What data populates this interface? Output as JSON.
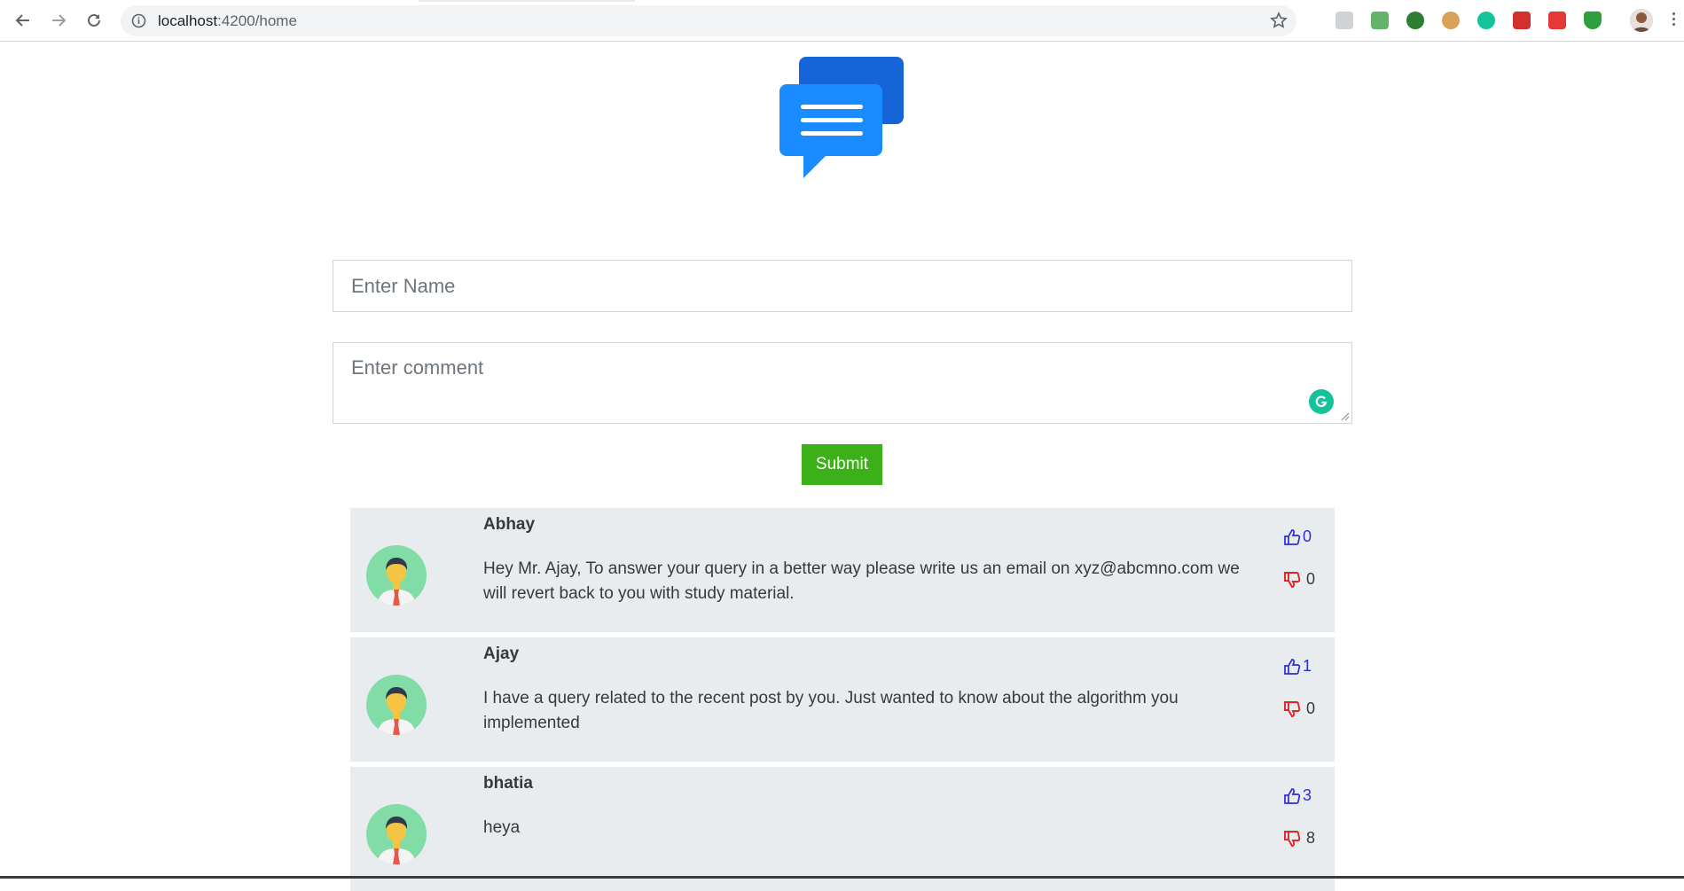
{
  "browser": {
    "url_host": "localhost",
    "url_path": ":4200/home"
  },
  "form": {
    "name_placeholder": "Enter Name",
    "comment_placeholder": "Enter comment",
    "submit_label": "Submit"
  },
  "comments": [
    {
      "name": "Abhay",
      "text": "Hey Mr. Ajay, To answer your query in a better way please write us an email on xyz@abcmno.com we will revert back to you with study material.",
      "likes": "0",
      "dislikes": "0"
    },
    {
      "name": "Ajay",
      "text": "I have a query related to the recent post by you. Just wanted to know about the algorithm you implemented",
      "likes": "1",
      "dislikes": "0"
    },
    {
      "name": "bhatia",
      "text": "heya",
      "likes": "3",
      "dislikes": "8"
    }
  ],
  "colors": {
    "like": "#2c2cd6",
    "dislike": "#e02424",
    "submit": "#3cb018",
    "card": "#e9ecef",
    "logo_front": "#1a8cff",
    "logo_back": "#1565d8"
  }
}
